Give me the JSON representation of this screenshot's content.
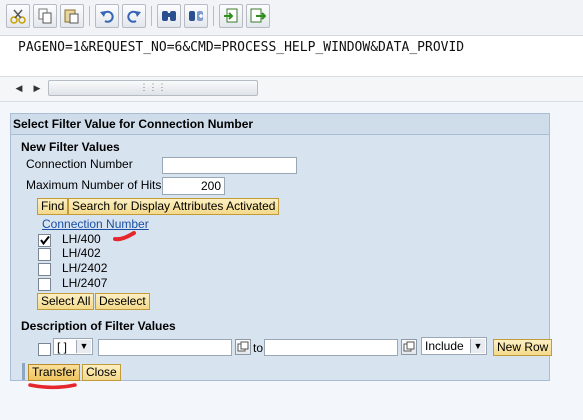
{
  "toolbar": {
    "icons": [
      "cut-icon",
      "copy-icon",
      "paste-icon",
      "undo-icon",
      "redo-icon",
      "find-icon",
      "find-next-icon",
      "import-icon",
      "export-icon"
    ]
  },
  "url": {
    "text": "PAGENO=1&REQUEST_NO=6&CMD=PROCESS_HELP_WINDOW&DATA_PROVID"
  },
  "panel": {
    "title": "Select Filter Value for Connection Number",
    "new_filter_heading": "New Filter Values",
    "connection_number_label": "Connection Number",
    "connection_number_value": "",
    "max_hits_label": "Maximum Number of Hits",
    "max_hits_value": "200",
    "find_label": "Find",
    "search_display_label": "Search for Display Attributes Activated",
    "column_link": "Connection Number",
    "values": [
      {
        "label": "LH/400",
        "checked": true
      },
      {
        "label": "LH/402",
        "checked": false
      },
      {
        "label": "LH/2402",
        "checked": false
      },
      {
        "label": "LH/2407",
        "checked": false
      }
    ],
    "select_all_label": "Select All",
    "deselect_label": "Deselect",
    "description_heading": "Description of Filter Values",
    "operator_value": "[ ]",
    "from_value": "",
    "to_label": "to",
    "to_value": "",
    "sign_value": "Include",
    "new_row_label": "New Row",
    "transfer_label": "Transfer",
    "close_label": "Close"
  },
  "colors": {
    "panel_bg": "#d8e3f0",
    "button_bg": "#f3d98a",
    "link": "#1a4fa3",
    "annotation": "#e5262c"
  }
}
